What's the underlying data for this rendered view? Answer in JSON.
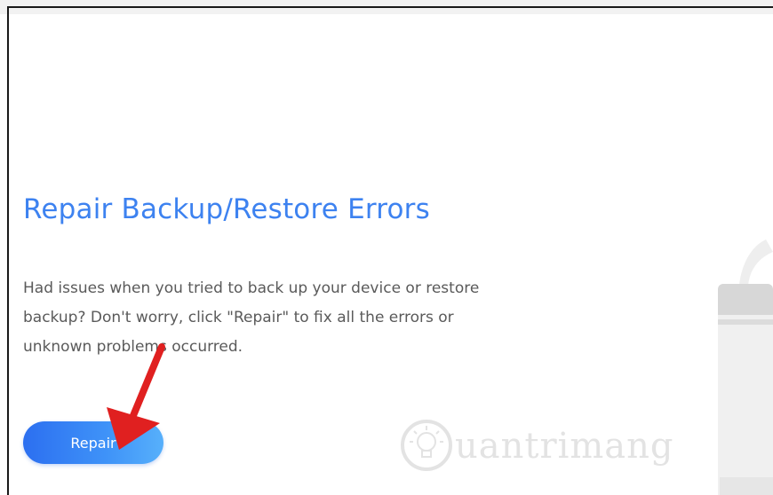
{
  "section": {
    "title": "Repair Backup/Restore Errors",
    "description_lines": [
      "Had issues when you tried to back up your device or restore",
      "backup? Don't worry, click \"Repair\" to fix all the errors or",
      "unknown problems occurred."
    ],
    "repair_button_label": "Repair"
  },
  "watermark": {
    "text": "uantrimang",
    "icon": "lightbulb-icon"
  },
  "colors": {
    "title": "#3d82f0",
    "button_start": "#2c6ff0",
    "button_end": "#57b0fb",
    "arrow": "#e02020"
  }
}
